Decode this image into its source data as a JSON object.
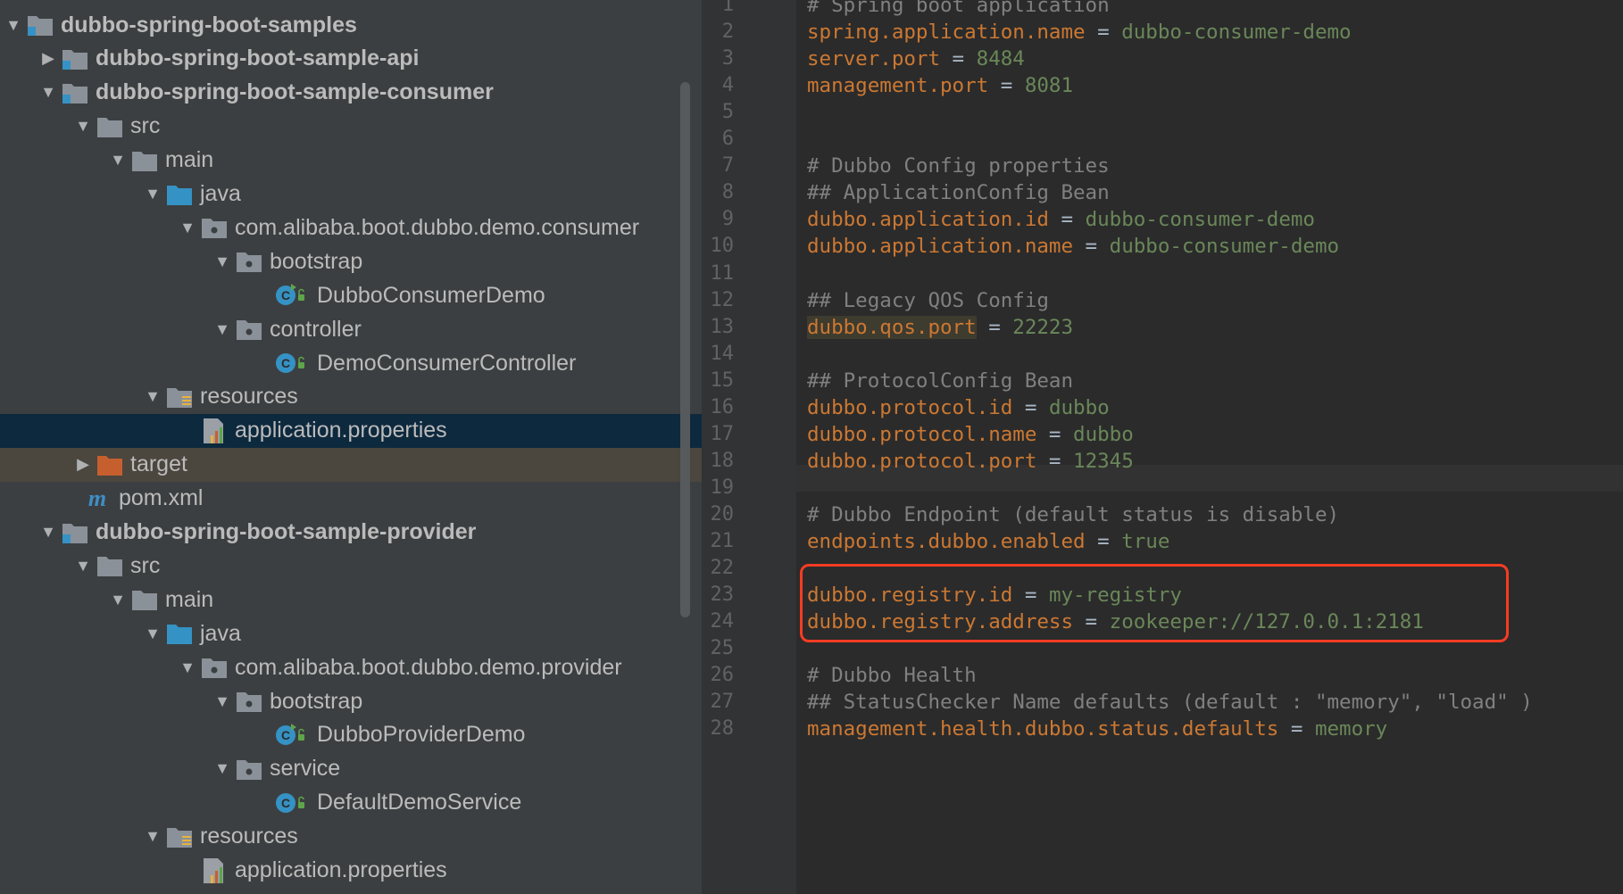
{
  "project_tree": {
    "rows": [
      {
        "label": "dubbo-spring-boot-samples",
        "arrow": "▼",
        "icon": "module",
        "bold": true
      },
      {
        "label": "dubbo-spring-boot-sample-api",
        "arrow": "▶",
        "icon": "module",
        "bold": true
      },
      {
        "label": "dubbo-spring-boot-sample-consumer",
        "arrow": "▼",
        "icon": "module",
        "bold": true
      },
      {
        "label": "src",
        "arrow": "▼",
        "icon": "folder-gray"
      },
      {
        "label": "main",
        "arrow": "▼",
        "icon": "folder-gray"
      },
      {
        "label": "java",
        "arrow": "▼",
        "icon": "folder-blue"
      },
      {
        "label": "com.alibaba.boot.dubbo.demo.consumer",
        "arrow": "▼",
        "icon": "package"
      },
      {
        "label": "bootstrap",
        "arrow": "▼",
        "icon": "package"
      },
      {
        "label": "DubboConsumerDemo",
        "arrow": "",
        "icon": "class-runnable"
      },
      {
        "label": "controller",
        "arrow": "▼",
        "icon": "package"
      },
      {
        "label": "DemoConsumerController",
        "arrow": "",
        "icon": "class"
      },
      {
        "label": "resources",
        "arrow": "▼",
        "icon": "folder-resources"
      },
      {
        "label": "application.properties",
        "arrow": "",
        "icon": "properties",
        "selected": true
      },
      {
        "label": "target",
        "arrow": "▶",
        "icon": "folder-orange",
        "excluded": true
      },
      {
        "label": "pom.xml",
        "arrow": "",
        "icon": "maven"
      },
      {
        "label": "dubbo-spring-boot-sample-provider",
        "arrow": "▼",
        "icon": "module",
        "bold": true
      },
      {
        "label": "src",
        "arrow": "▼",
        "icon": "folder-gray"
      },
      {
        "label": "main",
        "arrow": "▼",
        "icon": "folder-gray"
      },
      {
        "label": "java",
        "arrow": "▼",
        "icon": "folder-blue"
      },
      {
        "label": "com.alibaba.boot.dubbo.demo.provider",
        "arrow": "▼",
        "icon": "package"
      },
      {
        "label": "bootstrap",
        "arrow": "▼",
        "icon": "package"
      },
      {
        "label": "DubboProviderDemo",
        "arrow": "",
        "icon": "class-runnable"
      },
      {
        "label": "service",
        "arrow": "▼",
        "icon": "package"
      },
      {
        "label": "DefaultDemoService",
        "arrow": "",
        "icon": "class"
      },
      {
        "label": "resources",
        "arrow": "▼",
        "icon": "folder-resources"
      },
      {
        "label": "application.properties",
        "arrow": "",
        "icon": "properties"
      }
    ]
  },
  "editor": {
    "line_numbers": [
      "1",
      "2",
      "3",
      "4",
      "5",
      "6",
      "7",
      "8",
      "9",
      "10",
      "11",
      "12",
      "13",
      "14",
      "15",
      "16",
      "17",
      "18",
      "19",
      "20",
      "21",
      "22",
      "23",
      "24",
      "25",
      "26",
      "27",
      "28"
    ],
    "lines": [
      {
        "comment": "# Spring boot application"
      },
      {
        "key": "spring.application.name",
        "value": "dubbo-consumer-demo"
      },
      {
        "key": "server.port",
        "value": "8484"
      },
      {
        "key": "management.port",
        "value": "8081"
      },
      {},
      {},
      {
        "comment": "# Dubbo Config properties"
      },
      {
        "comment": "## ApplicationConfig Bean"
      },
      {
        "key": "dubbo.application.id",
        "value": "dubbo-consumer-demo"
      },
      {
        "key": "dubbo.application.name",
        "value": "dubbo-consumer-demo"
      },
      {},
      {
        "comment": "## Legacy QOS Config"
      },
      {
        "key": "dubbo.qos.port",
        "value": "22223"
      },
      {},
      {
        "comment": "## ProtocolConfig Bean"
      },
      {
        "key": "dubbo.protocol.id",
        "value": "dubbo"
      },
      {
        "key": "dubbo.protocol.name",
        "value": "dubbo"
      },
      {
        "key": "dubbo.protocol.port",
        "value": "12345"
      },
      {},
      {
        "comment": "# Dubbo Endpoint (default status is disable)"
      },
      {
        "key": "endpoints.dubbo.enabled",
        "value": "true"
      },
      {},
      {
        "key": "dubbo.registry.id",
        "value": "my-registry"
      },
      {
        "key": "dubbo.registry.address",
        "value": "zookeeper://127.0.0.1:2181"
      },
      {},
      {
        "comment": "# Dubbo Health"
      },
      {
        "comment": "## StatusChecker Name defaults (default : \"memory\", \"load\" )"
      },
      {
        "key": "management.health.dubbo.status.defaults",
        "value": "memory"
      }
    ]
  },
  "colors": {
    "key": "#cc7832",
    "value": "#6a8759",
    "comment": "#808080",
    "highlight_box": "#f53c23",
    "selection": "#0d293e"
  }
}
